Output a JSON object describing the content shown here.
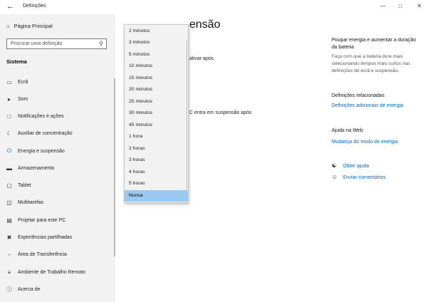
{
  "window": {
    "title": "Definições",
    "back_icon": "back-arrow-icon"
  },
  "sidebar": {
    "home_label": "Página Principal",
    "search_placeholder": "Procurar uma definição",
    "section_title": "Sistema",
    "items": [
      {
        "label": "Ecrã",
        "icon": "monitor-icon",
        "active": false
      },
      {
        "label": "Som",
        "icon": "speaker-icon",
        "active": false
      },
      {
        "label": "Notificações e ações",
        "icon": "notification-icon",
        "active": false
      },
      {
        "label": "Auxiliar de concentração",
        "icon": "moon-icon",
        "active": false
      },
      {
        "label": "Energia e suspensão",
        "icon": "power-icon",
        "active": true
      },
      {
        "label": "Armazenamento",
        "icon": "storage-icon",
        "active": false
      },
      {
        "label": "Tablet",
        "icon": "tablet-icon",
        "active": false
      },
      {
        "label": "Multitarefas",
        "icon": "multitask-icon",
        "active": false
      },
      {
        "label": "Projetar para este PC",
        "icon": "project-icon",
        "active": false
      },
      {
        "label": "Experiências partilhadas",
        "icon": "shared-icon",
        "active": false
      },
      {
        "label": "Área de Transferência",
        "icon": "clipboard-icon",
        "active": false
      },
      {
        "label": "Ambiente de Trabalho Remoto",
        "icon": "remote-desktop-icon",
        "active": false
      },
      {
        "label": "Acerca de",
        "icon": "info-icon",
        "active": false
      }
    ]
  },
  "main": {
    "title_visible": "ensão",
    "text1": "ativar após",
    "text2": "C entra em suspensão após"
  },
  "dropdown": {
    "options": [
      "2 minutos",
      "3 minutos",
      "5 minutos",
      "10 minutos",
      "15 minutos",
      "20 minutos",
      "25 minutos",
      "30 minutos",
      "45 minutos",
      "1 hora",
      "2 horas",
      "3 horas",
      "4 horas",
      "5 horas",
      "Nunca"
    ],
    "selected": "Nunca"
  },
  "right": {
    "battery_title": "Poupar energia e aumentar a duração da bateria",
    "battery_text": "Faça com que a bateria dure mais selecionando tempos mais curtos nas definições de ecrã e suspensão.",
    "related_title": "Definições relacionadas",
    "related_link": "Definições adicionais de energia",
    "web_help_title": "Ajuda na Web",
    "web_help_link": "Mudança do modo de energia",
    "get_help": "Obter ajuda",
    "feedback": "Enviar comentários"
  },
  "colors": {
    "accent": "#0067c0",
    "selected_option": "#99c8f3",
    "sidebar_bg": "#f2f2f2"
  }
}
